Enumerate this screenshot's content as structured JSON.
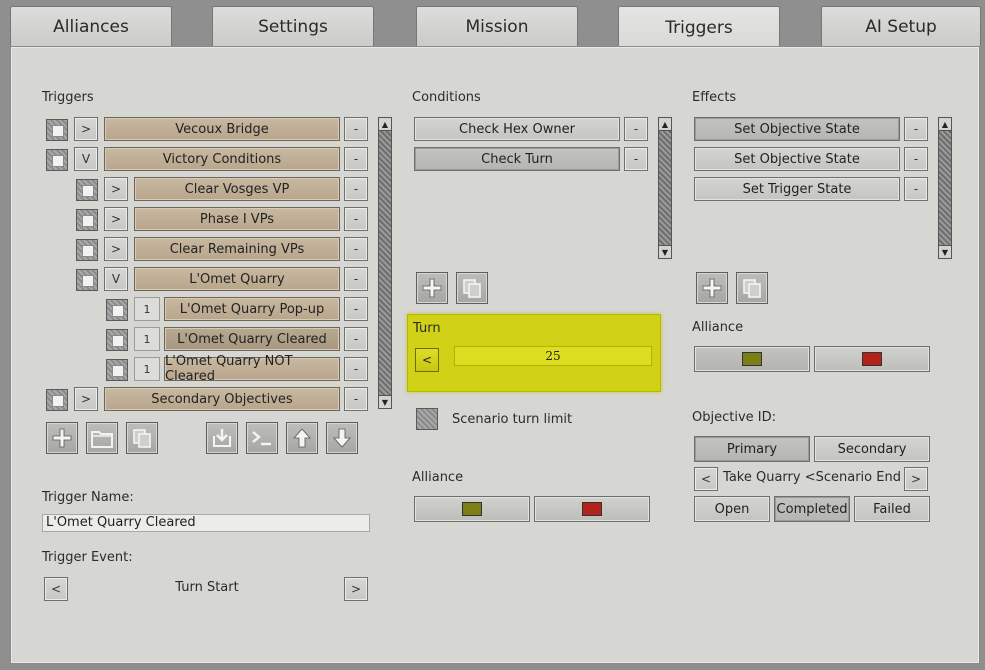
{
  "tabs": [
    {
      "label": "Alliances"
    },
    {
      "label": "Settings"
    },
    {
      "label": "Mission"
    },
    {
      "label": "Triggers"
    },
    {
      "label": "AI Setup"
    }
  ],
  "triggers": {
    "heading": "Triggers",
    "items": [
      {
        "label": "Vecoux Bridge",
        "toggle": ">"
      },
      {
        "label": "Victory Conditions",
        "toggle": "V"
      },
      {
        "label": "Clear Vosges VP",
        "toggle": ">"
      },
      {
        "label": "Phase I VPs",
        "toggle": ">"
      },
      {
        "label": "Clear Remaining VPs",
        "toggle": ">"
      },
      {
        "label": "L'Omet Quarry",
        "toggle": "V"
      },
      {
        "label": "L'Omet Quarry Pop-up",
        "toggle": "1"
      },
      {
        "label": "L'Omet Quarry Cleared",
        "toggle": "1"
      },
      {
        "label": "L'Omet Quarry NOT Cleared",
        "toggle": "1"
      },
      {
        "label": "Secondary Objectives",
        "toggle": ">"
      }
    ],
    "remove_label": "-",
    "name_label": "Trigger Name:",
    "name_value": "L'Omet Quarry Cleared",
    "event_label": "Trigger Event:",
    "event_value": "Turn Start",
    "prev": "<",
    "next": ">"
  },
  "conditions": {
    "heading": "Conditions",
    "items": [
      {
        "label": "Check Hex Owner"
      },
      {
        "label": "Check Turn"
      }
    ],
    "remove_label": "-",
    "turn_label": "Turn",
    "turn_prev": "<",
    "turn_value": "25",
    "limit_label": "Scenario turn limit",
    "alliance_label": "Alliance"
  },
  "effects": {
    "heading": "Effects",
    "items": [
      {
        "label": "Set Objective State"
      },
      {
        "label": "Set Objective State"
      },
      {
        "label": "Set Trigger State"
      }
    ],
    "remove_label": "-",
    "alliance_label": "Alliance",
    "objective_label": "Objective ID:",
    "primary": "Primary",
    "secondary": "Secondary",
    "objective_prev": "<",
    "objective_value": "Take Quarry <Scenario End",
    "objective_next": ">",
    "states": [
      "Open",
      "Completed",
      "Failed"
    ]
  },
  "colors": {
    "alliance_green": "#7b7f16",
    "alliance_red": "#b3231b",
    "turn_highlight": "#d1d117",
    "trigger_row": "#c3b39a"
  }
}
